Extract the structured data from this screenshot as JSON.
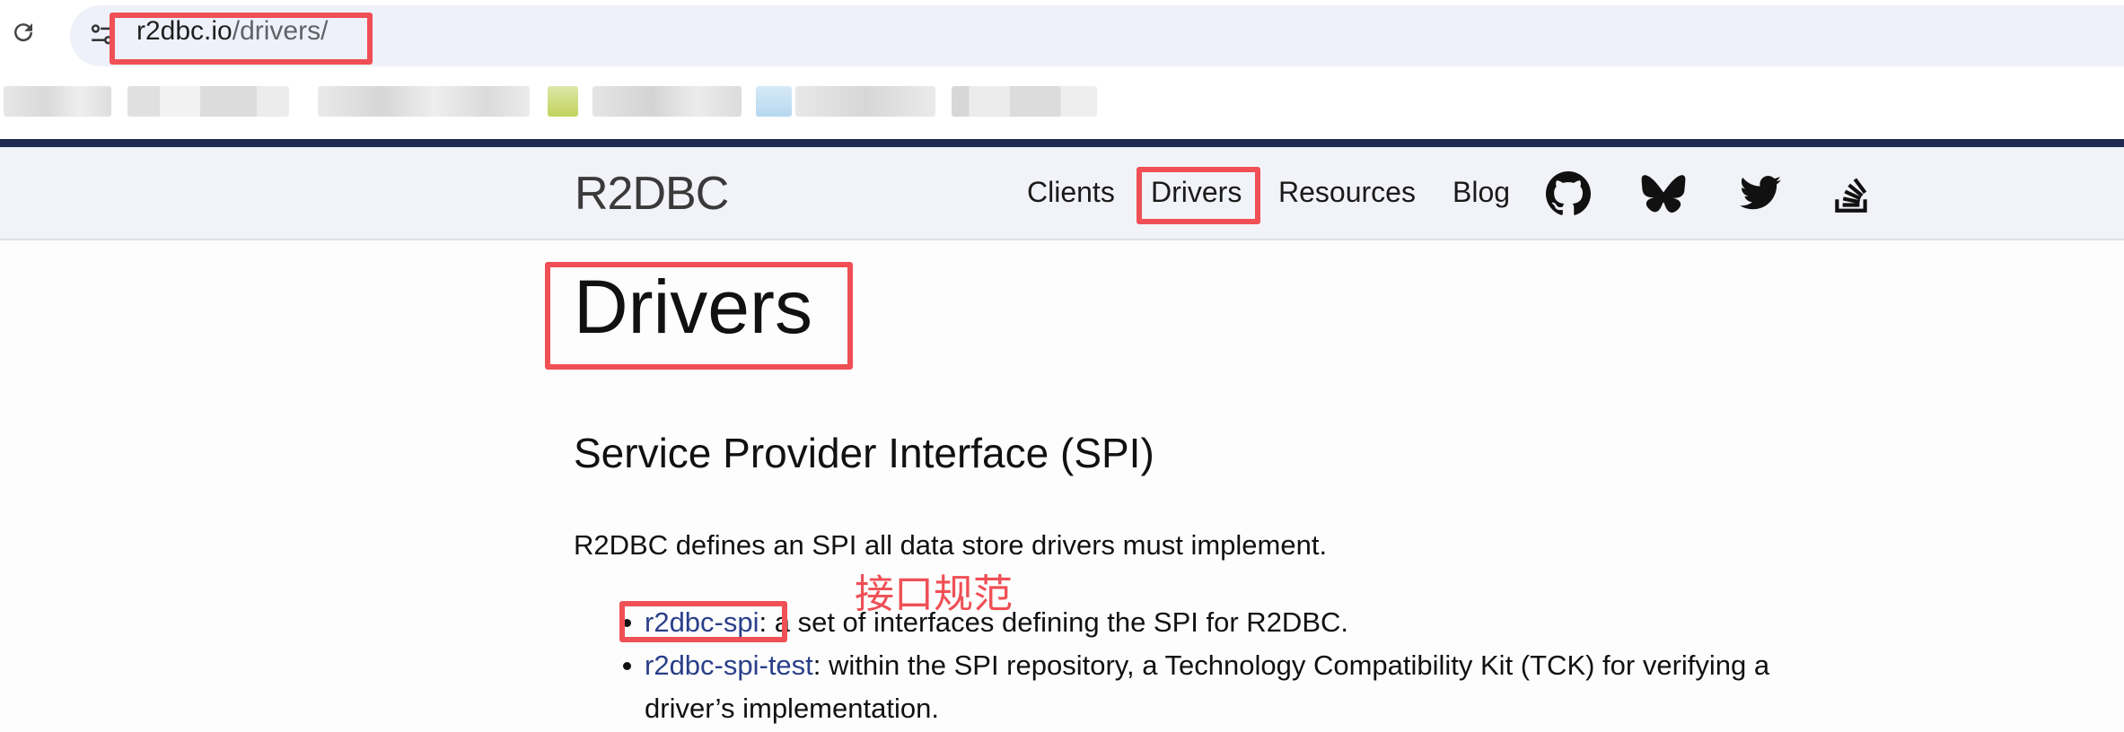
{
  "browser": {
    "url_host": "r2dbc.io",
    "url_path": "/drivers/"
  },
  "site": {
    "brand": "R2DBC",
    "nav": [
      {
        "label": "Clients"
      },
      {
        "label": "Drivers"
      },
      {
        "label": "Resources"
      },
      {
        "label": "Blog"
      }
    ],
    "social_icons": [
      "github-icon",
      "bluesky-icon",
      "twitter-icon",
      "stackoverflow-icon"
    ]
  },
  "content": {
    "title": "Drivers",
    "section_heading": "Service Provider Interface (SPI)",
    "intro": "R2DBC defines an SPI all data store drivers must implement.",
    "items": [
      {
        "link": "r2dbc-spi",
        "text": ": a set of interfaces defining the SPI for R2DBC."
      },
      {
        "link": "r2dbc-spi-test",
        "text": ": within the SPI repository, a Technology Compatibility Kit (TCK) for verifying a",
        "text_cont": "driver’s implementation."
      }
    ]
  },
  "annotation": {
    "note": "接口规范",
    "color": "#ef4f55"
  },
  "colors": {
    "nav_background": "#f2f3f8",
    "top_line": "#1f2a52",
    "link": "#2a3f8a"
  }
}
